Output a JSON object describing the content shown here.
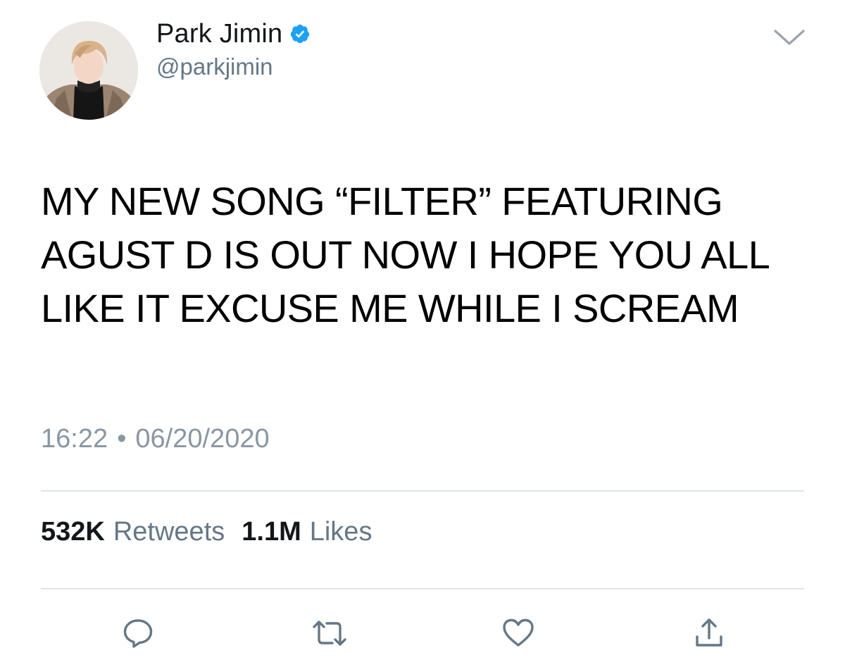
{
  "author": {
    "display_name": "Park Jimin",
    "handle": "@parkjimin",
    "verified": true,
    "verified_color": "#1da1f2"
  },
  "tweet": {
    "text": "MY NEW SONG “FILTER” FEATURING AGUST D IS OUT NOW I HOPE YOU ALL LIKE IT EXCUSE ME WHILE I SCREAM",
    "time": "16:22",
    "separator": "•",
    "date": "06/20/2020"
  },
  "stats": {
    "retweets_count": "532K",
    "retweets_label": "Retweets",
    "likes_count": "1.1M",
    "likes_label": "Likes"
  },
  "actions": {
    "reply_icon": "reply-icon",
    "retweet_icon": "retweet-icon",
    "like_icon": "heart-icon",
    "share_icon": "share-icon",
    "icon_color": "#657786"
  },
  "menu": {
    "icon": "chevron-down-icon",
    "color": "#9aa4ad"
  }
}
